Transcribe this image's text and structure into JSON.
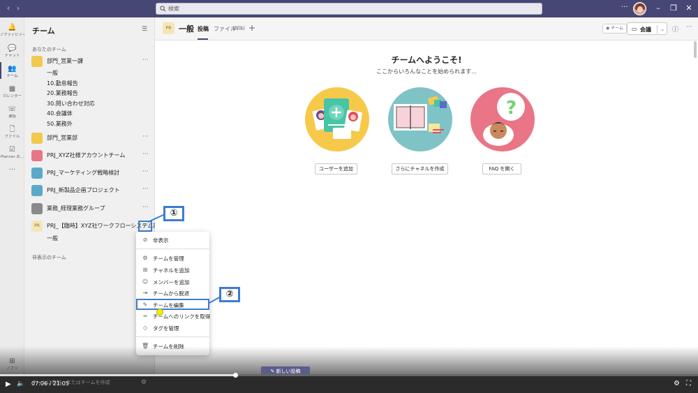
{
  "search": {
    "placeholder": "検索"
  },
  "rail": [
    {
      "icon": "bell-icon",
      "glyph": "🔔",
      "label": "アクティビティ"
    },
    {
      "icon": "chat-icon",
      "glyph": "💬",
      "label": "チャット"
    },
    {
      "icon": "teams-icon",
      "glyph": "👥",
      "label": "チーム"
    },
    {
      "icon": "calendar-icon",
      "glyph": "▦",
      "label": "カレンダー"
    },
    {
      "icon": "phone-icon",
      "glyph": "☏",
      "label": "通話"
    },
    {
      "icon": "file-icon",
      "glyph": "🗋",
      "label": "ファイル"
    },
    {
      "icon": "planner-icon",
      "glyph": "☑",
      "label": "Planner お..."
    },
    {
      "icon": "more-icon",
      "glyph": "···",
      "label": ""
    }
  ],
  "rail_apps": {
    "glyph": "⊞",
    "label": "アプリ"
  },
  "panel": {
    "title": "チーム",
    "your_teams_label": "あなたのチーム",
    "hidden_teams_label": "非表示のチーム",
    "bottom_hint": "チームに参加、またはチームを作成"
  },
  "teams": [
    {
      "name": "部門_営業一課",
      "avatar_bg": "#f2c94c"
    },
    {
      "name": "部門_営業部",
      "avatar_bg": "#f2c94c"
    },
    {
      "name": "PRJ_XYZ社様アカウントチーム",
      "avatar_bg": "#e97586"
    },
    {
      "name": "PRJ_マーケティング戦略検討",
      "avatar_bg": "#5aa9c9"
    },
    {
      "name": "PRJ_新製品企画プロジェクト",
      "avatar_bg": "#5aa9c9"
    },
    {
      "name": "業務_経理業務グループ",
      "avatar_bg": "#8a8a8a"
    },
    {
      "name": "PRJ_【臨時】XYZ社ワークフローシステム提案",
      "avatar_bg": "#f4e6b8",
      "avatar_text": "PR"
    }
  ],
  "team1_channels": [
    "一般",
    "10.勤怠報告",
    "20.業務報告",
    "30.問い合わせ対応",
    "40.会議体",
    "50.業務外"
  ],
  "team7_channels": [
    "一般"
  ],
  "callouts": [
    "①",
    "②"
  ],
  "channel_header": {
    "avatar_text": "PR",
    "name": "一般",
    "tabs": [
      "投稿",
      "ファイル",
      "Wiki"
    ],
    "team_button": "チーム",
    "meet_button": "会議"
  },
  "welcome": {
    "title": "チームへようこそ!",
    "subtitle": "ここからいろんなことを始められます...",
    "buttons": [
      "ユーザーを追加",
      "さらにチャネルを作成",
      "FAQ を開く"
    ]
  },
  "context_menu": [
    {
      "icon": "hide-icon",
      "glyph": "⊘",
      "label": "非表示"
    },
    {
      "icon": "gear-icon",
      "glyph": "⚙",
      "label": "チームを管理"
    },
    {
      "icon": "add-channel-icon",
      "glyph": "⊞",
      "label": "チャネルを追加"
    },
    {
      "icon": "add-member-icon",
      "glyph": "☺",
      "label": "メンバーを追加"
    },
    {
      "icon": "leave-icon",
      "glyph": "⇥",
      "label": "チームから脱退"
    },
    {
      "icon": "pencil-icon",
      "glyph": "✎",
      "label": "チームを編集"
    },
    {
      "icon": "link-icon",
      "glyph": "∞",
      "label": "チームへのリンクを取得"
    },
    {
      "icon": "tag-icon",
      "glyph": "◇",
      "label": "タグを管理"
    },
    {
      "icon": "trash-icon",
      "glyph": "🗑",
      "label": "チームを削除"
    }
  ],
  "new_post": "新しい投稿",
  "video": {
    "time": "07:06 / 21:05",
    "progress_fraction": 0.337
  }
}
